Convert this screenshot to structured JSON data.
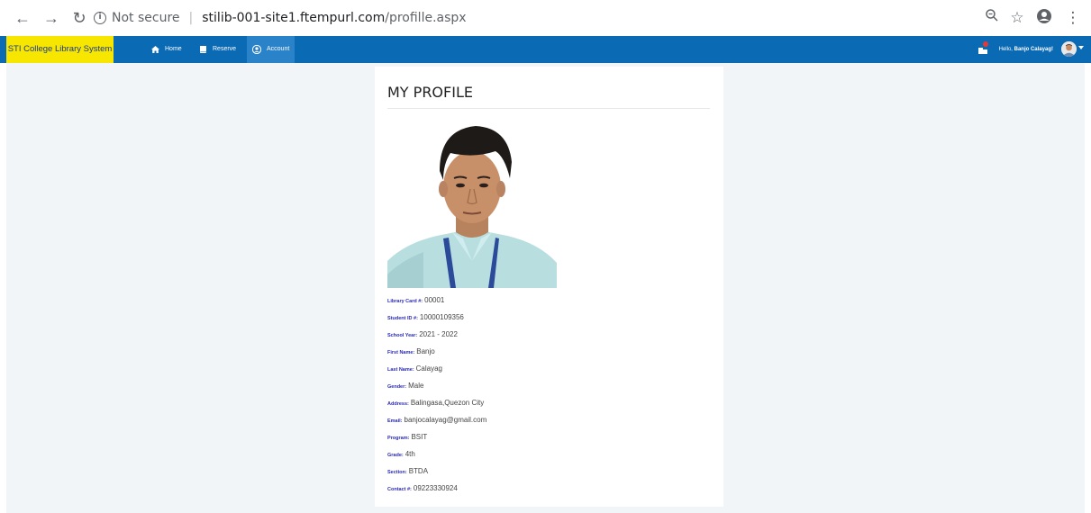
{
  "browser": {
    "security_label": "Not secure",
    "host": "stilib-001-site1.ftempurl.com",
    "path": "/profille.aspx"
  },
  "nav": {
    "brand": "STI College Library System",
    "items": [
      {
        "label": "Home",
        "icon": "home-icon"
      },
      {
        "label": "Reserve",
        "icon": "book-icon"
      },
      {
        "label": "Account",
        "icon": "user-circle-icon"
      }
    ],
    "greeting_prefix": "Hello, ",
    "user_name": "Banjo Calayag!"
  },
  "profile": {
    "title": "MY PROFILE",
    "fields": [
      {
        "label": "Library Card #:",
        "value": "00001"
      },
      {
        "label": "Student ID #:",
        "value": "10000109356"
      },
      {
        "label": "School Year:",
        "value": "2021 - 2022"
      },
      {
        "label": "First Name:",
        "value": "Banjo"
      },
      {
        "label": "Last Name:",
        "value": "Calayag"
      },
      {
        "label": "Gender:",
        "value": "Male"
      },
      {
        "label": "Address:",
        "value": "Balingasa,Quezon City"
      },
      {
        "label": "Email:",
        "value": "banjocalayag@gmail.com"
      },
      {
        "label": "Program:",
        "value": "BSIT"
      },
      {
        "label": "Grade:",
        "value": "4th"
      },
      {
        "label": "Section:",
        "value": "BTDA"
      },
      {
        "label": "Contact #:",
        "value": "09223330924"
      }
    ]
  },
  "colors": {
    "nav_bg": "#0a6ab4",
    "brand_bg": "#f7e600",
    "label_color": "#2a2ab8"
  }
}
